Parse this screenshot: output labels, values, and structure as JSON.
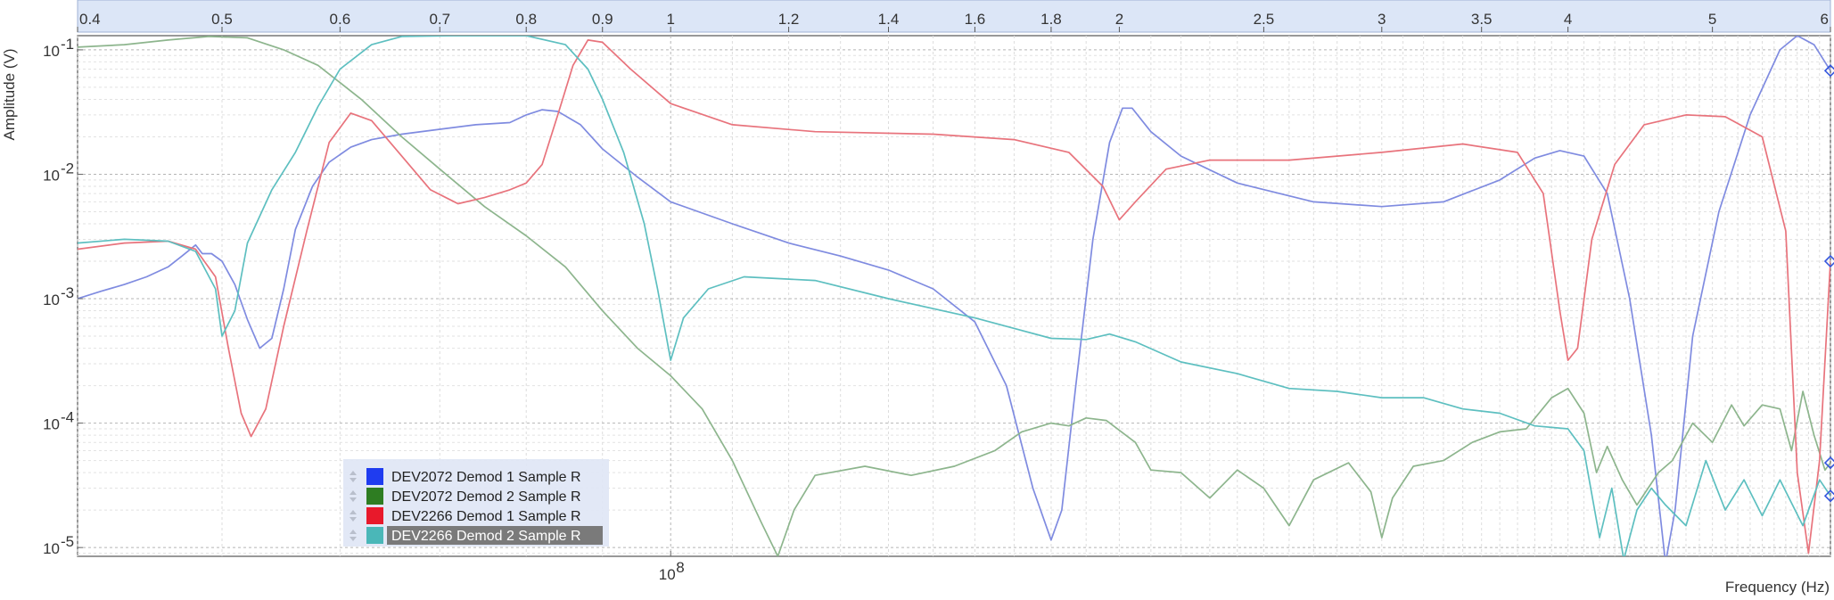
{
  "chart_data": {
    "type": "line",
    "xlabel": "Frequency (Hz)",
    "ylabel": "Amplitude (V)",
    "x_scale": "log",
    "y_scale": "log",
    "xlim": [
      40000000,
      600000000
    ],
    "ylim": [
      8.5e-06,
      0.13
    ],
    "x_tick_value": 100000000,
    "x_tick_label": "10",
    "x_tick_exp": "8",
    "y_ticks": [
      {
        "value": 1e-05,
        "base": "10",
        "exp": "-5"
      },
      {
        "value": 0.0001,
        "base": "10",
        "exp": "-4"
      },
      {
        "value": 0.001,
        "base": "10",
        "exp": "-3"
      },
      {
        "value": 0.01,
        "base": "10",
        "exp": "-2"
      },
      {
        "value": 0.1,
        "base": "10",
        "exp": "-1"
      }
    ],
    "top_scale_ticks": [
      {
        "value": 0.4,
        "label": "0.4"
      },
      {
        "value": 0.5,
        "label": "0.5"
      },
      {
        "value": 0.6,
        "label": "0.6"
      },
      {
        "value": 0.7,
        "label": "0.7"
      },
      {
        "value": 0.8,
        "label": "0.8"
      },
      {
        "value": 0.9,
        "label": "0.9"
      },
      {
        "value": 1.0,
        "label": "1"
      },
      {
        "value": 1.2,
        "label": "1.2"
      },
      {
        "value": 1.4,
        "label": "1.4"
      },
      {
        "value": 1.6,
        "label": "1.6"
      },
      {
        "value": 1.8,
        "label": "1.8"
      },
      {
        "value": 2.0,
        "label": "2"
      },
      {
        "value": 2.5,
        "label": "2.5"
      },
      {
        "value": 3.0,
        "label": "3"
      },
      {
        "value": 3.5,
        "label": "3.5"
      },
      {
        "value": 4.0,
        "label": "4"
      },
      {
        "value": 5.0,
        "label": "5"
      },
      {
        "value": 6.0,
        "label": "6"
      }
    ],
    "grid": true,
    "legend_position": "bottom-left",
    "series": [
      {
        "name": "DEV2072 Demod 1 Sample R",
        "color": "#7f8be0",
        "legend_color": "#1f3cf0",
        "points": [
          [
            40000000,
            0.001
          ],
          [
            41500000,
            0.00115
          ],
          [
            43000000,
            0.0013
          ],
          [
            44500000,
            0.0015
          ],
          [
            46000000,
            0.0018
          ],
          [
            47000000,
            0.0022
          ],
          [
            48000000,
            0.0027
          ],
          [
            48500000,
            0.0023
          ],
          [
            49200000,
            0.0023
          ],
          [
            50000000,
            0.002
          ],
          [
            51000000,
            0.0013
          ],
          [
            52000000,
            0.00068
          ],
          [
            53000000,
            0.0004
          ],
          [
            54000000,
            0.00048
          ],
          [
            55000000,
            0.0012
          ],
          [
            56000000,
            0.0036
          ],
          [
            57500000,
            0.008
          ],
          [
            59000000,
            0.0125
          ],
          [
            61000000,
            0.0165
          ],
          [
            63000000,
            0.019
          ],
          [
            66000000,
            0.021
          ],
          [
            70000000,
            0.023
          ],
          [
            74000000,
            0.025
          ],
          [
            78000000,
            0.026
          ],
          [
            80000000,
            0.03
          ],
          [
            82000000,
            0.033
          ],
          [
            84000000,
            0.032
          ],
          [
            87000000,
            0.025
          ],
          [
            90000000,
            0.016
          ],
          [
            95000000,
            0.0095
          ],
          [
            100000000,
            0.006
          ],
          [
            110000000,
            0.004
          ],
          [
            120000000,
            0.0028
          ],
          [
            130000000,
            0.0022
          ],
          [
            140000000,
            0.0017
          ],
          [
            150000000,
            0.0012
          ],
          [
            160000000,
            0.00065
          ],
          [
            168000000,
            0.0002
          ],
          [
            175000000,
            3e-05
          ],
          [
            180000000,
            1.15e-05
          ],
          [
            183000000,
            2e-05
          ],
          [
            187000000,
            0.0002
          ],
          [
            192000000,
            0.003
          ],
          [
            197000000,
            0.018
          ],
          [
            201000000,
            0.034
          ],
          [
            204000000,
            0.034
          ],
          [
            210000000,
            0.022
          ],
          [
            220000000,
            0.014
          ],
          [
            240000000,
            0.0085
          ],
          [
            270000000,
            0.006
          ],
          [
            300000000,
            0.0055
          ],
          [
            330000000,
            0.006
          ],
          [
            360000000,
            0.009
          ],
          [
            380000000,
            0.0135
          ],
          [
            395000000,
            0.0155
          ],
          [
            410000000,
            0.014
          ],
          [
            425000000,
            0.007
          ],
          [
            440000000,
            0.001
          ],
          [
            455000000,
            8e-05
          ],
          [
            465000000,
            7.5e-06
          ],
          [
            472000000,
            2e-05
          ],
          [
            485000000,
            0.0005
          ],
          [
            505000000,
            0.005
          ],
          [
            530000000,
            0.03
          ],
          [
            555000000,
            0.1
          ],
          [
            570000000,
            0.13
          ],
          [
            585000000,
            0.11
          ],
          [
            600000000,
            0.068
          ]
        ]
      },
      {
        "name": "DEV2072 Demod 2 Sample R",
        "color": "#8db58d",
        "legend_color": "#2e7d22",
        "points": [
          [
            40000000,
            0.105
          ],
          [
            43000000,
            0.11
          ],
          [
            46000000,
            0.12
          ],
          [
            49000000,
            0.128
          ],
          [
            52000000,
            0.125
          ],
          [
            55000000,
            0.1
          ],
          [
            58000000,
            0.075
          ],
          [
            62000000,
            0.04
          ],
          [
            66000000,
            0.02
          ],
          [
            70000000,
            0.011
          ],
          [
            75000000,
            0.0055
          ],
          [
            80000000,
            0.0032
          ],
          [
            85000000,
            0.0018
          ],
          [
            90000000,
            0.0008
          ],
          [
            95000000,
            0.0004
          ],
          [
            100000000,
            0.00024
          ],
          [
            105000000,
            0.00013
          ],
          [
            110000000,
            5e-05
          ],
          [
            115000000,
            1.6e-05
          ],
          [
            118000000,
            8.5e-06
          ],
          [
            121000000,
            2e-05
          ],
          [
            125000000,
            3.8e-05
          ],
          [
            135000000,
            4.5e-05
          ],
          [
            145000000,
            3.8e-05
          ],
          [
            155000000,
            4.5e-05
          ],
          [
            165000000,
            6e-05
          ],
          [
            172000000,
            8.5e-05
          ],
          [
            180000000,
            0.0001
          ],
          [
            185000000,
            9.5e-05
          ],
          [
            190000000,
            0.00011
          ],
          [
            196000000,
            0.000105
          ],
          [
            205000000,
            7e-05
          ],
          [
            210000000,
            4.2e-05
          ],
          [
            220000000,
            4e-05
          ],
          [
            230000000,
            2.5e-05
          ],
          [
            240000000,
            4.2e-05
          ],
          [
            250000000,
            3e-05
          ],
          [
            260000000,
            1.5e-05
          ],
          [
            270000000,
            3.5e-05
          ],
          [
            285000000,
            4.8e-05
          ],
          [
            295000000,
            2.8e-05
          ],
          [
            300000000,
            1.2e-05
          ],
          [
            305000000,
            2.5e-05
          ],
          [
            315000000,
            4.5e-05
          ],
          [
            330000000,
            5e-05
          ],
          [
            345000000,
            7e-05
          ],
          [
            360000000,
            8.5e-05
          ],
          [
            375000000,
            9e-05
          ],
          [
            390000000,
            0.00016
          ],
          [
            400000000,
            0.00019
          ],
          [
            410000000,
            0.00012
          ],
          [
            418000000,
            4e-05
          ],
          [
            425000000,
            6.5e-05
          ],
          [
            435000000,
            3.5e-05
          ],
          [
            445000000,
            2.2e-05
          ],
          [
            460000000,
            4e-05
          ],
          [
            470000000,
            5e-05
          ],
          [
            485000000,
            0.0001
          ],
          [
            500000000,
            7e-05
          ],
          [
            515000000,
            0.00014
          ],
          [
            525000000,
            9.5e-05
          ],
          [
            540000000,
            0.00014
          ],
          [
            555000000,
            0.00013
          ],
          [
            565000000,
            6e-05
          ],
          [
            575000000,
            0.00018
          ],
          [
            585000000,
            8e-05
          ],
          [
            595000000,
            4.2e-05
          ],
          [
            600000000,
            4.8e-05
          ]
        ]
      },
      {
        "name": "DEV2266 Demod 1 Sample R",
        "color": "#e8737c",
        "legend_color": "#e8192b",
        "points": [
          [
            40000000,
            0.0025
          ],
          [
            43000000,
            0.0028
          ],
          [
            46000000,
            0.0029
          ],
          [
            48000000,
            0.0025
          ],
          [
            49500000,
            0.0015
          ],
          [
            50500000,
            0.0004
          ],
          [
            51500000,
            0.00012
          ],
          [
            52300000,
            7.8e-05
          ],
          [
            53500000,
            0.00013
          ],
          [
            55000000,
            0.0006
          ],
          [
            57000000,
            0.0035
          ],
          [
            59000000,
            0.018
          ],
          [
            61000000,
            0.031
          ],
          [
            63000000,
            0.027
          ],
          [
            66000000,
            0.014
          ],
          [
            69000000,
            0.0075
          ],
          [
            72000000,
            0.0058
          ],
          [
            75000000,
            0.0065
          ],
          [
            78000000,
            0.0075
          ],
          [
            80000000,
            0.0085
          ],
          [
            82000000,
            0.012
          ],
          [
            84000000,
            0.03
          ],
          [
            86000000,
            0.075
          ],
          [
            88000000,
            0.12
          ],
          [
            90000000,
            0.115
          ],
          [
            94000000,
            0.07
          ],
          [
            100000000,
            0.037
          ],
          [
            110000000,
            0.025
          ],
          [
            125000000,
            0.022
          ],
          [
            150000000,
            0.021
          ],
          [
            170000000,
            0.019
          ],
          [
            185000000,
            0.015
          ],
          [
            195000000,
            0.008
          ],
          [
            200000000,
            0.0043
          ],
          [
            205000000,
            0.006
          ],
          [
            215000000,
            0.011
          ],
          [
            230000000,
            0.013
          ],
          [
            260000000,
            0.013
          ],
          [
            300000000,
            0.015
          ],
          [
            340000000,
            0.0175
          ],
          [
            370000000,
            0.015
          ],
          [
            385000000,
            0.007
          ],
          [
            395000000,
            0.0008
          ],
          [
            400000000,
            0.00032
          ],
          [
            406000000,
            0.0004
          ],
          [
            415000000,
            0.003
          ],
          [
            430000000,
            0.012
          ],
          [
            450000000,
            0.025
          ],
          [
            480000000,
            0.03
          ],
          [
            510000000,
            0.029
          ],
          [
            540000000,
            0.02
          ],
          [
            560000000,
            0.0035
          ],
          [
            570000000,
            4e-05
          ],
          [
            580000000,
            9e-06
          ],
          [
            590000000,
            5e-05
          ],
          [
            600000000,
            0.002
          ]
        ]
      },
      {
        "name": "DEV2266 Demod 2 Sample R",
        "color": "#5dbfc0",
        "legend_color": "#4ab7b8",
        "points": [
          [
            40000000,
            0.0028
          ],
          [
            43000000,
            0.003
          ],
          [
            46000000,
            0.0029
          ],
          [
            48000000,
            0.0024
          ],
          [
            49500000,
            0.0012
          ],
          [
            50000000,
            0.0005
          ],
          [
            51000000,
            0.0008
          ],
          [
            52000000,
            0.0028
          ],
          [
            54000000,
            0.0075
          ],
          [
            56000000,
            0.015
          ],
          [
            58000000,
            0.035
          ],
          [
            60000000,
            0.07
          ],
          [
            63000000,
            0.11
          ],
          [
            66000000,
            0.128
          ],
          [
            72000000,
            0.13
          ],
          [
            80000000,
            0.13
          ],
          [
            85000000,
            0.11
          ],
          [
            88000000,
            0.07
          ],
          [
            90000000,
            0.04
          ],
          [
            93000000,
            0.015
          ],
          [
            96000000,
            0.004
          ],
          [
            98000000,
            0.0012
          ],
          [
            100000000,
            0.00032
          ],
          [
            102000000,
            0.0007
          ],
          [
            106000000,
            0.0012
          ],
          [
            112000000,
            0.0015
          ],
          [
            125000000,
            0.0014
          ],
          [
            140000000,
            0.001
          ],
          [
            160000000,
            0.0007
          ],
          [
            180000000,
            0.00048
          ],
          [
            190000000,
            0.00047
          ],
          [
            197000000,
            0.00052
          ],
          [
            205000000,
            0.00045
          ],
          [
            220000000,
            0.00031
          ],
          [
            240000000,
            0.00025
          ],
          [
            260000000,
            0.00019
          ],
          [
            280000000,
            0.00018
          ],
          [
            300000000,
            0.00016
          ],
          [
            320000000,
            0.00016
          ],
          [
            340000000,
            0.00013
          ],
          [
            360000000,
            0.00012
          ],
          [
            380000000,
            9.5e-05
          ],
          [
            400000000,
            9e-05
          ],
          [
            410000000,
            6e-05
          ],
          [
            420000000,
            1.2e-05
          ],
          [
            428000000,
            3e-05
          ],
          [
            436000000,
            8e-06
          ],
          [
            445000000,
            2e-05
          ],
          [
            455000000,
            3e-05
          ],
          [
            465000000,
            2.2e-05
          ],
          [
            480000000,
            1.5e-05
          ],
          [
            495000000,
            5e-05
          ],
          [
            510000000,
            2e-05
          ],
          [
            525000000,
            3.5e-05
          ],
          [
            540000000,
            1.8e-05
          ],
          [
            555000000,
            3.5e-05
          ],
          [
            575000000,
            1.5e-05
          ],
          [
            590000000,
            3.5e-05
          ],
          [
            600000000,
            2.6e-05
          ]
        ]
      }
    ]
  }
}
